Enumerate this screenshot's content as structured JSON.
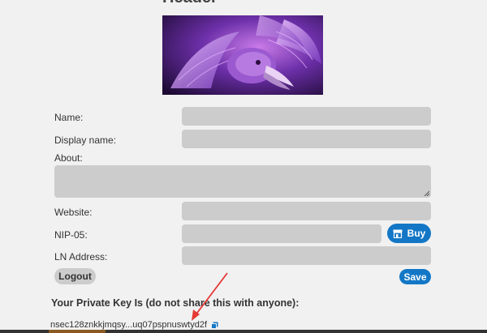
{
  "header": {
    "title": "Header"
  },
  "form": {
    "name_label": "Name:",
    "display_name_label": "Display name:",
    "about_label": "About:",
    "website_label": "Website:",
    "nip05_label": "NIP-05:",
    "ln_address_label": "LN Address:",
    "name_value": "",
    "display_name_value": "",
    "about_value": "",
    "website_value": "",
    "nip05_value": "",
    "ln_address_value": ""
  },
  "buttons": {
    "buy_label": "Buy",
    "logout_label": "Logout",
    "save_label": "Save"
  },
  "private_key": {
    "heading": "Your Private Key Is (do not share this with anyone):",
    "value": "nsec128znkkjmqsy...uq07pspnuswtyd2f"
  },
  "colors": {
    "accent": "#1377c6",
    "field_bg": "#cccccc",
    "page_bg": "#f1f1f1",
    "annotation_arrow": "#e53935"
  },
  "icons": {
    "buy": "store-icon",
    "copy": "copy-icon"
  }
}
